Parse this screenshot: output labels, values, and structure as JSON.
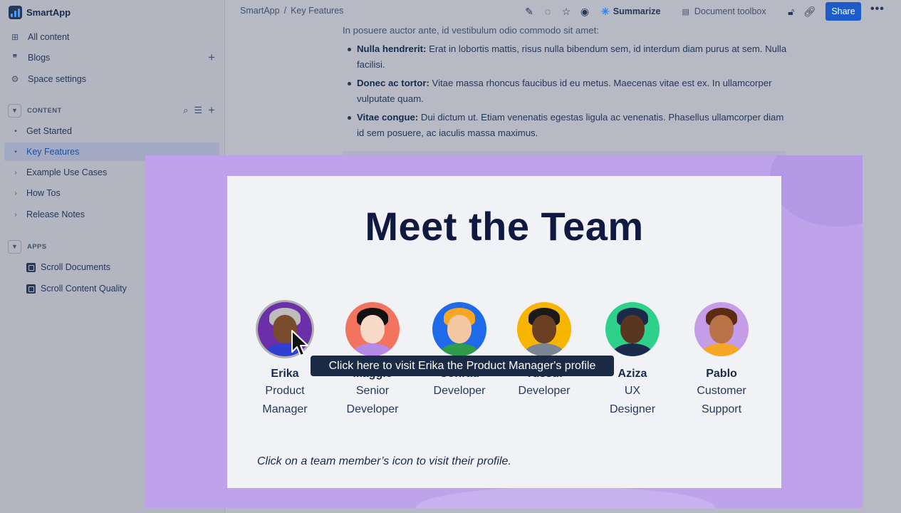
{
  "app": {
    "name": "SmartApp"
  },
  "sidebar": {
    "nav": [
      {
        "label": "All content",
        "icon": "grid-icon"
      },
      {
        "label": "Blogs",
        "icon": "quote-icon"
      },
      {
        "label": "Space settings",
        "icon": "gear-icon"
      }
    ],
    "content_section": {
      "label": "CONTENT",
      "items": [
        {
          "label": "Get Started",
          "marker": "dot"
        },
        {
          "label": "Key Features",
          "marker": "dot",
          "active": true
        },
        {
          "label": "Example Use Cases",
          "marker": "chevron"
        },
        {
          "label": "How Tos",
          "marker": "chevron"
        },
        {
          "label": "Release Notes",
          "marker": "chevron"
        }
      ]
    },
    "apps_section": {
      "label": "APPS",
      "items": [
        {
          "label": "Scroll Documents"
        },
        {
          "label": "Scroll Content Quality"
        }
      ]
    }
  },
  "topbar": {
    "breadcrumb": [
      "SmartApp",
      "Key Features"
    ],
    "breadcrumb_sep": "/",
    "summarize": "Summarize",
    "toolbox": "Document toolbox",
    "share": "Share",
    "more": "•••"
  },
  "doc": {
    "intro": "In posuere auctor ante, id vestibulum odio commodo sit amet:",
    "bullets": [
      {
        "term": "Nulla hendrerit:",
        "text": " Erat in lobortis mattis, risus nulla bibendum sem, id interdum diam purus at sem. Nulla facilisi."
      },
      {
        "term": "Donec ac tortor:",
        "text": " Vitae massa rhoncus faucibus id eu metus. Maecenas vitae est ex. In ullamcorper vulputate quam."
      },
      {
        "term": "Vitae congue:",
        "text": " Dui dictum ut. Etiam venenatis egestas ligula ac venenatis. Phasellus ullamcorper diam id sem posuere, ac iaculis massa maximus."
      }
    ]
  },
  "team_card": {
    "title": "Meet the Team",
    "members": [
      {
        "name": "Erika",
        "role_1": "Product",
        "role_2": "Manager",
        "bg": "#6b2fa8",
        "skin": "#7a4a2c",
        "hair": "#bdbdbd",
        "shirt": "#2f3fd1"
      },
      {
        "name": "Maggie",
        "role_1": "Senior",
        "role_2": "Developer",
        "bg": "#f2745f",
        "skin": "#f7d9c7",
        "hair": "#111111",
        "shirt": "#b58ae6"
      },
      {
        "name": "Conrad",
        "role_1": "Developer",
        "role_2": "",
        "bg": "#1e6ae8",
        "skin": "#f3c7a0",
        "hair": "#f5a623",
        "shirt": "#2e9c4a"
      },
      {
        "name": "Yussuf",
        "role_1": "Developer",
        "role_2": "",
        "bg": "#f7b500",
        "skin": "#6b3f22",
        "hair": "#1a1a1a",
        "shirt": "#7b8594"
      },
      {
        "name": "Aziza",
        "role_1": "UX",
        "role_2": "Designer",
        "bg": "#2ed18a",
        "skin": "#5a3520",
        "hair": "#1b2a4a",
        "shirt": "#1b2a4a"
      },
      {
        "name": "Pablo",
        "role_1": "Customer",
        "role_2": "Support",
        "bg": "#c59ce8",
        "skin": "#b87349",
        "hair": "#5b2c12",
        "shirt": "#f5a623"
      }
    ],
    "tooltip": "Click here to visit Erika the Product Manager's profile",
    "hint": "Click on a team member’s icon to visit their profile."
  }
}
